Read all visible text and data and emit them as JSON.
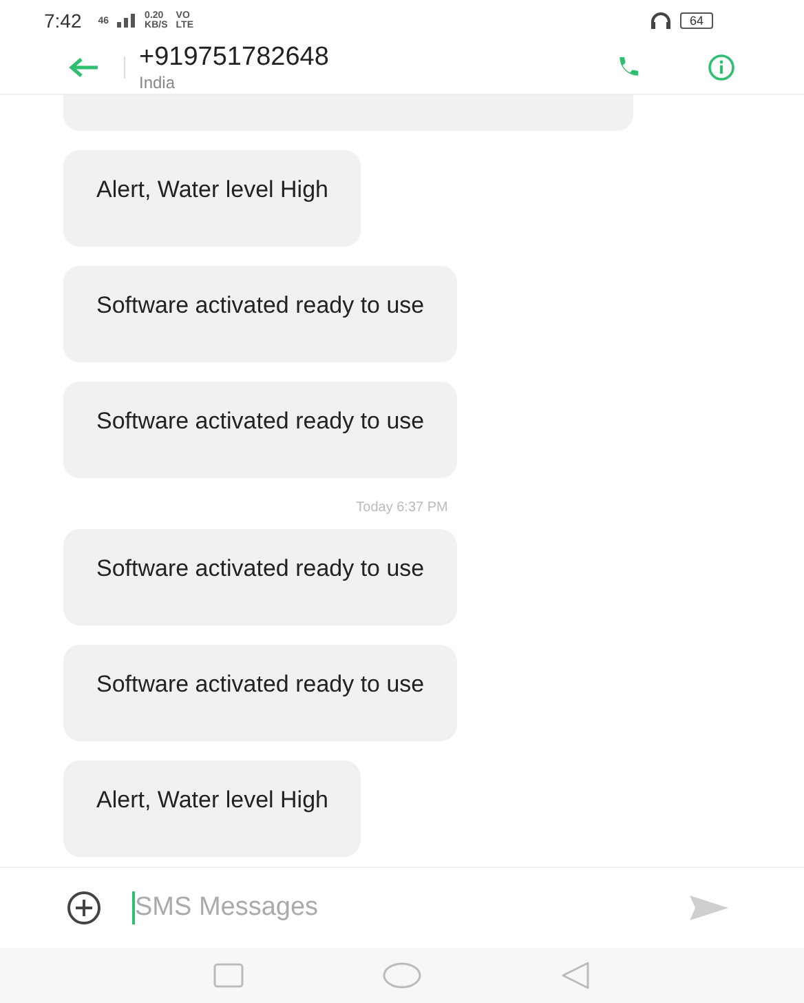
{
  "status_bar": {
    "time": "7:42",
    "network": "46",
    "speed": "0.20",
    "speed_unit": "KB/S",
    "volte_top": "VO",
    "volte_bottom": "LTE",
    "battery": "64"
  },
  "header": {
    "title": "+919751782648",
    "subtitle": "India"
  },
  "messages": [
    {
      "kind": "message",
      "text": "Alert, Water level High"
    },
    {
      "kind": "message",
      "text": "Software activated ready to use"
    },
    {
      "kind": "message",
      "text": "Software activated ready to use"
    },
    {
      "kind": "timestamp",
      "text": "Today 6:37 PM"
    },
    {
      "kind": "message",
      "text": "Software activated ready to use"
    },
    {
      "kind": "message",
      "text": "Software activated ready to use"
    },
    {
      "kind": "message",
      "text": "Alert, Water level High"
    }
  ],
  "composer": {
    "placeholder": "SMS Messages"
  }
}
